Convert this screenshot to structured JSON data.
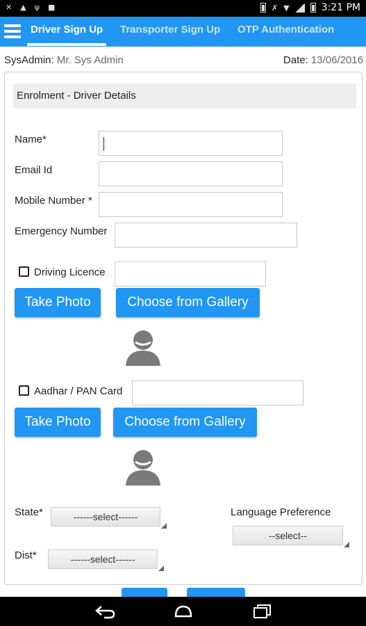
{
  "status_bar": {
    "left_icons": [
      "notification-icon",
      "warning-icon",
      "usb-icon",
      "image-icon"
    ],
    "right_icons": [
      "battery-icon",
      "mute-icon",
      "wifi-icon",
      "signal-icon",
      "battery-level-icon"
    ],
    "time": "3:21 PM"
  },
  "app_bar": {
    "tabs": [
      {
        "label": "Driver Sign Up",
        "active": true
      },
      {
        "label": "Transporter Sign Up",
        "active": false
      },
      {
        "label": "OTP Authentication",
        "active": false
      }
    ]
  },
  "info": {
    "sysadmin_label": "SysAdmin:",
    "sysadmin_value": "Mr. Sys Admin",
    "date_label": "Date:",
    "date_value": "13/06/2016"
  },
  "form": {
    "header": "Enrolment - Driver Details",
    "name_label": "Name*",
    "name_value": "",
    "email_label": "Email Id",
    "email_value": "",
    "mobile_label": "Mobile Number *",
    "mobile_value": "",
    "emergency_label": "Emergency Number",
    "emergency_value": "",
    "driving_licence_label": "Driving Licence",
    "driving_licence_checked": false,
    "driving_licence_value": "",
    "take_photo_label": "Take Photo",
    "gallery_label": "Choose from Gallery",
    "aadhar_label": "Aadhar / PAN Card",
    "aadhar_checked": false,
    "aadhar_value": "",
    "state_label": "State*",
    "state_value": "------select------",
    "language_label": "Language Preference",
    "language_value": "--select--",
    "dist_label": "Dist*",
    "dist_value": "------select------"
  },
  "colors": {
    "primary": "#2196f3",
    "status_bar": "#000000"
  }
}
